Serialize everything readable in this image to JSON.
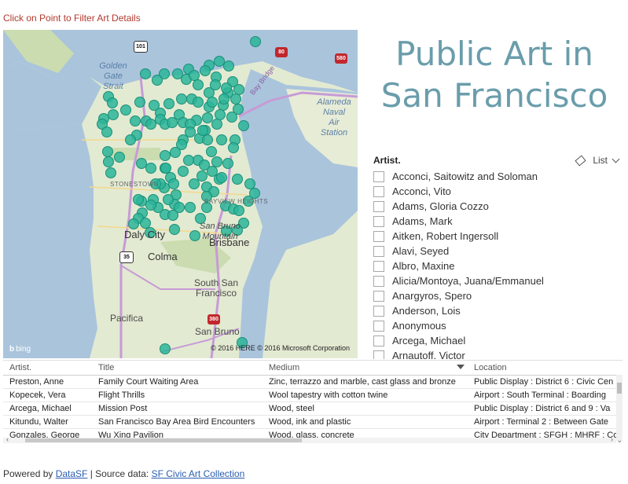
{
  "map": {
    "caption": "Click on Point to Filter Art Details",
    "labels": {
      "golden_gate_strait": "Golden\nGate\nStrait",
      "alameda_naval": "Alameda\nNaval\nAir\nStation",
      "stonestown": "STONESTOWN",
      "bayview": "BAYVIEW HEIGHTS",
      "san_bruno_mountain": "San Bruno\nMountain",
      "daly_city": "Daly City",
      "brisbane": "Brisbane",
      "colma": "Colma",
      "south_sf": "South San\nFrancisco",
      "pacifica": "Pacifica",
      "san_bruno": "San Bruno",
      "bay_bridge": "Bay Bridge"
    },
    "shields": {
      "us101": "101",
      "i80": "80",
      "i580": "580",
      "ca35": "35",
      "i380": "380"
    },
    "bing_label": "bing",
    "copyright": "© 2016 HERE   © 2016 Microsoft Corporation",
    "point_color": "#2bb59a"
  },
  "title": {
    "line1": "Public Art in",
    "line2": "San Francisco"
  },
  "slicer": {
    "field": "Artist.",
    "mode_label": "List",
    "items": [
      "Acconci, Saitowitz and Soloman",
      "Acconci, Vito",
      "Adams, Gloria Cozzo",
      "Adams, Mark",
      "Aitken, Robert Ingersoll",
      "Alavi, Seyed",
      "Albro, Maxine",
      "Alicia/Montoya, Juana/Emmanuel",
      "Anargyros, Spero",
      "Anderson, Lois",
      "Anonymous",
      "Arcega, Michael",
      "Arnautoff, Victor"
    ]
  },
  "table": {
    "columns": [
      "Artist.",
      "Title",
      "Medium",
      "Location"
    ],
    "rows": [
      [
        "Preston, Anne",
        "Family Court Waiting Area",
        "Zinc, terrazzo and marble, cast glass and bronze",
        "Public Display : District 6 : Civic Cen"
      ],
      [
        "Kopecek, Vera",
        "Flight Thrills",
        "Wool tapestry with cotton twine",
        "Airport : South Terminal : Boarding"
      ],
      [
        "Arcega, Michael",
        "Mission Post",
        "Wood, steel",
        "Public Display : District 6 and 9 : Va"
      ],
      [
        "Kitundu, Walter",
        "San Francisco Bay Area Bird Encounters",
        "Wood, ink and plastic",
        "Airport : Terminal 2 : Between Gate"
      ],
      [
        "Gonzales, George",
        "Wu Xing Pavilion",
        "Wood, glass, concrete",
        "City Department : SFGH : MHRF : Co"
      ]
    ]
  },
  "footer": {
    "prefix": "Powered by ",
    "link1": "DataSF",
    "sep": " | Source data:  ",
    "link2": "SF Civic Art Collection"
  }
}
